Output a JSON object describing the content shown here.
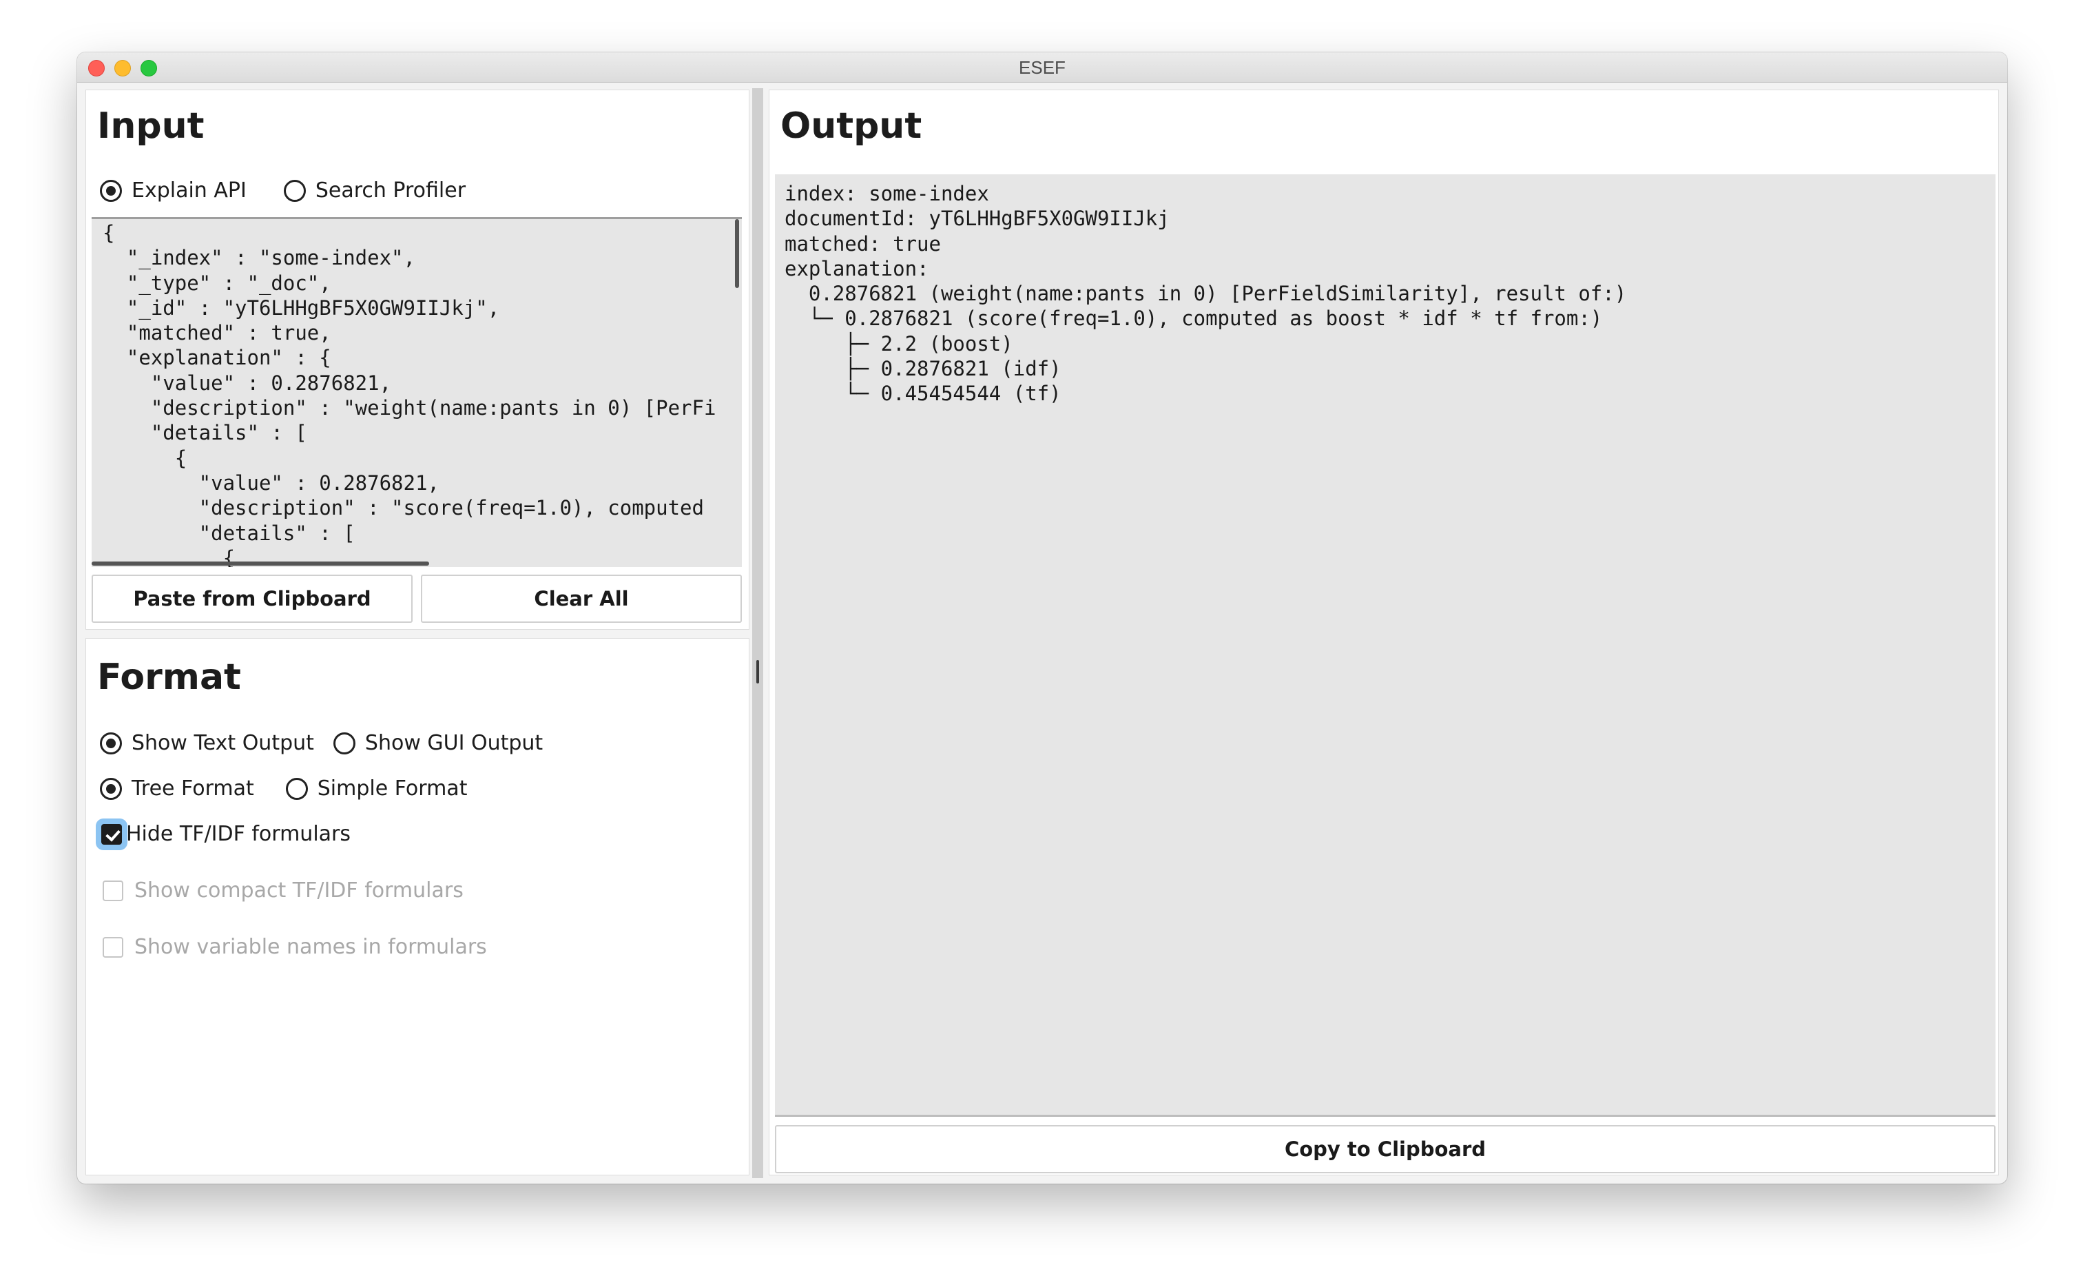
{
  "window": {
    "title": "ESEF"
  },
  "input": {
    "title": "Input",
    "modes": [
      {
        "label": "Explain API",
        "selected": true
      },
      {
        "label": "Search Profiler",
        "selected": false
      }
    ],
    "code_lines": [
      "{",
      "  \"_index\" : \"some-index\",",
      "  \"_type\" : \"_doc\",",
      "  \"_id\" : \"yT6LHHgBF5X0GW9IIJkj\",",
      "  \"matched\" : true,",
      "  \"explanation\" : {",
      "    \"value\" : 0.2876821,",
      "    \"description\" : \"weight(name:pants in 0) [PerFi",
      "    \"details\" : [",
      "      {",
      "        \"value\" : 0.2876821,",
      "        \"description\" : \"score(freq=1.0), computed",
      "        \"details\" : [",
      "          {"
    ],
    "paste_label": "Paste from Clipboard",
    "clear_label": "Clear All"
  },
  "format": {
    "title": "Format",
    "output_modes": [
      {
        "label": "Show Text Output",
        "selected": true
      },
      {
        "label": "Show GUI Output",
        "selected": false
      }
    ],
    "tree_modes": [
      {
        "label": "Tree Format",
        "selected": true
      },
      {
        "label": "Simple Format",
        "selected": false
      }
    ],
    "options": [
      {
        "label": "Hide TF/IDF formulars",
        "checked": true,
        "enabled": true
      },
      {
        "label": "Show compact TF/IDF formulars",
        "checked": false,
        "enabled": false
      },
      {
        "label": "Show variable names in formulars",
        "checked": false,
        "enabled": false
      }
    ]
  },
  "output": {
    "title": "Output",
    "lines": [
      "index: some-index",
      "documentId: yT6LHHgBF5X0GW9IIJkj",
      "matched: true",
      "explanation:",
      "  0.2876821 (weight(name:pants in 0) [PerFieldSimilarity], result of:)",
      "  └─ 0.2876821 (score(freq=1.0), computed as boost * idf * tf from:)",
      "     ├─ 2.2 (boost)",
      "     ├─ 0.2876821 (idf)",
      "     └─ 0.45454544 (tf)"
    ],
    "copy_label": "Copy to Clipboard"
  }
}
